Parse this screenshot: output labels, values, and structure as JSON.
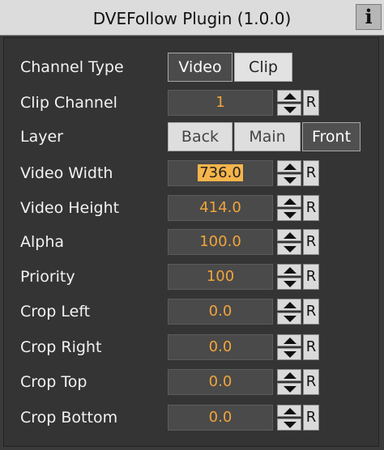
{
  "window": {
    "title": "DVEFollow Plugin (1.0.0)",
    "info_label": "i"
  },
  "channel_type": {
    "label": "Channel Type",
    "options": [
      "Video",
      "Clip"
    ],
    "selected": "Clip"
  },
  "clip_channel": {
    "label": "Clip Channel",
    "value": "1"
  },
  "layer": {
    "label": "Layer",
    "options": [
      "Back",
      "Main",
      "Front"
    ],
    "selected": "Main"
  },
  "fields": [
    {
      "label": "Video Width",
      "value": "736.0"
    },
    {
      "label": "Video Height",
      "value": "414.0"
    },
    {
      "label": "Alpha",
      "value": "100.0"
    },
    {
      "label": "Priority",
      "value": "100"
    },
    {
      "label": "Crop Left",
      "value": "0.0"
    },
    {
      "label": "Crop Right",
      "value": "0.0"
    },
    {
      "label": "Crop Top",
      "value": "0.0"
    },
    {
      "label": "Crop Bottom",
      "value": "0.0"
    }
  ],
  "reset_label": "R",
  "colors": {
    "panel_bg": "#3a3a3a",
    "value_text": "#f2a43a",
    "selected_value_bg": "#f6b54a"
  }
}
